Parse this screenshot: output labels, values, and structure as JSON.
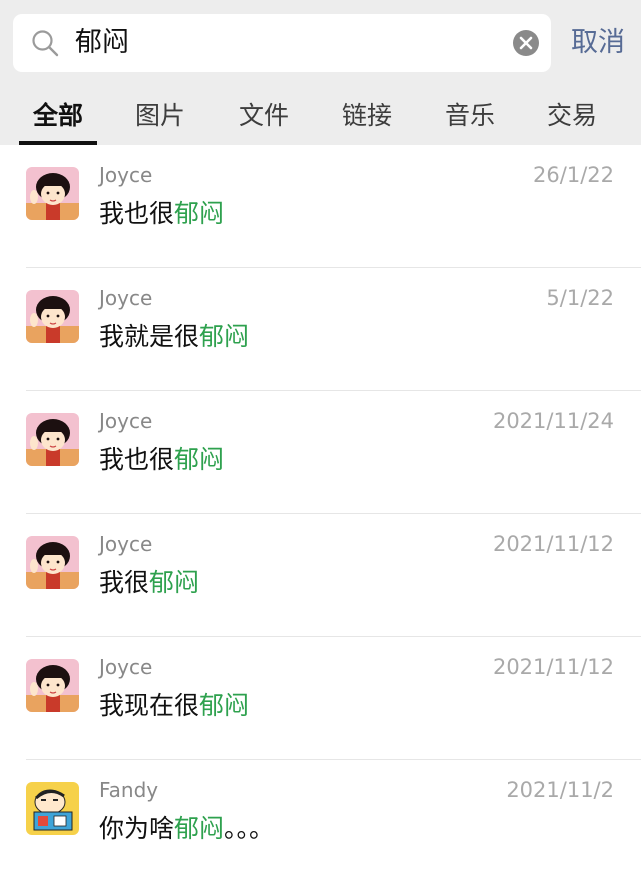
{
  "search": {
    "query": "郁闷",
    "cancel_label": "取消"
  },
  "tabs": [
    {
      "label": "全部",
      "active": true
    },
    {
      "label": "图片",
      "active": false
    },
    {
      "label": "文件",
      "active": false
    },
    {
      "label": "链接",
      "active": false
    },
    {
      "label": "音乐",
      "active": false
    },
    {
      "label": "交易",
      "active": false
    }
  ],
  "colors": {
    "highlight": "#2ea14e",
    "cancel": "#576b95",
    "header_bg": "#ededed"
  },
  "results": [
    {
      "name": "Joyce",
      "date": "26/1/22",
      "prefix": "我也很",
      "match": "郁闷",
      "suffix": "",
      "avatar": "maruko-avatar"
    },
    {
      "name": "Joyce",
      "date": "5/1/22",
      "prefix": "我就是很",
      "match": "郁闷",
      "suffix": "",
      "avatar": "maruko-avatar"
    },
    {
      "name": "Joyce",
      "date": "2021/11/24",
      "prefix": "我也很",
      "match": "郁闷",
      "suffix": "",
      "avatar": "maruko-avatar"
    },
    {
      "name": "Joyce",
      "date": "2021/11/12",
      "prefix": "我很",
      "match": "郁闷",
      "suffix": "",
      "avatar": "maruko-avatar"
    },
    {
      "name": "Joyce",
      "date": "2021/11/12",
      "prefix": "我现在很",
      "match": "郁闷",
      "suffix": "",
      "avatar": "maruko-avatar"
    },
    {
      "name": "Fandy",
      "date": "2021/11/2",
      "prefix": "你为啥",
      "match": "郁闷",
      "suffix": "。。。",
      "avatar": "shinchan-avatar"
    }
  ]
}
